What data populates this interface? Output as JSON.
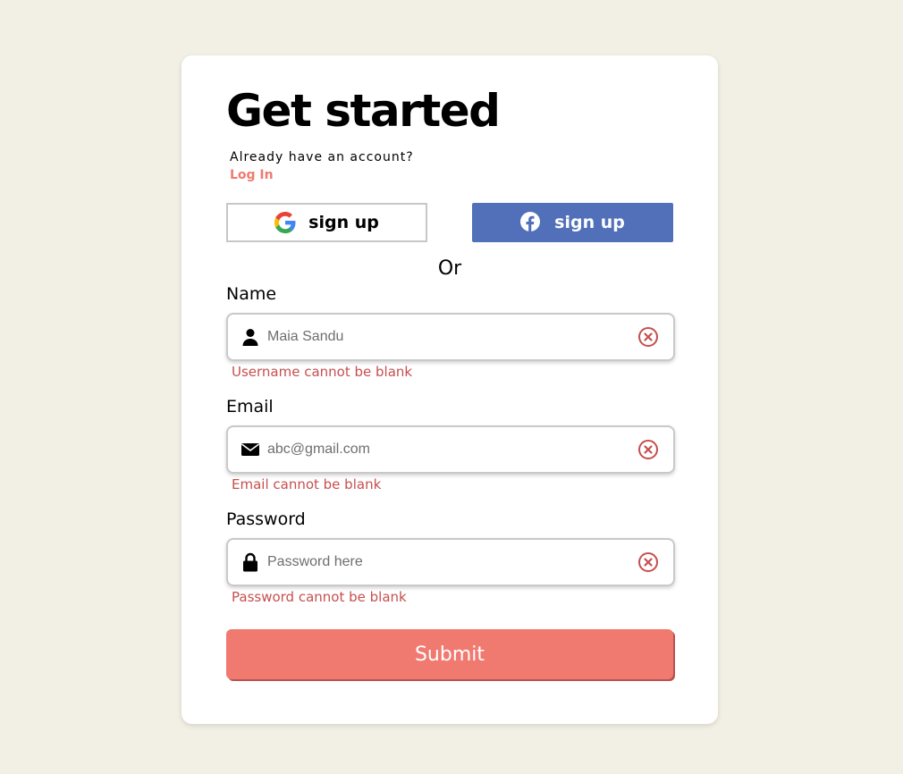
{
  "header": {
    "title": "Get started",
    "account_prompt": "Already have an account?",
    "login_link": "Log In"
  },
  "social": {
    "google_label": "sign up",
    "facebook_label": "sign up",
    "google_icon": "google-icon",
    "facebook_icon": "facebook-icon"
  },
  "divider_text": "Or",
  "fields": {
    "name": {
      "label": "Name",
      "placeholder": "Maia Sandu",
      "value": "",
      "icon": "user-icon",
      "error": "Username cannot be blank"
    },
    "email": {
      "label": "Email",
      "placeholder": "abc@gmail.com",
      "value": "",
      "icon": "envelope-icon",
      "error": "Email cannot be blank"
    },
    "password": {
      "label": "Password",
      "placeholder": "Password here",
      "value": "",
      "icon": "lock-icon",
      "error": "Password cannot be blank"
    }
  },
  "submit_label": "Submit",
  "colors": {
    "background": "#f2efe4",
    "accent": "#f07a6f",
    "facebook": "#5170b9",
    "error": "#c64f4f"
  }
}
